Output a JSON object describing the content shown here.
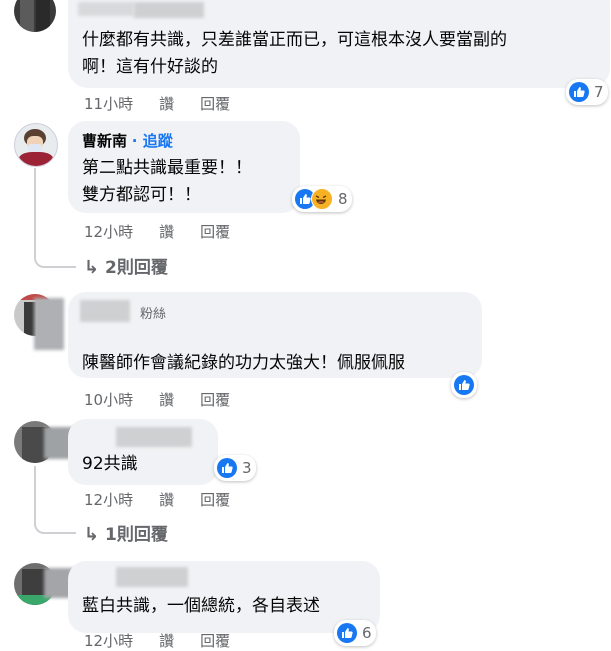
{
  "actions": {
    "like": "讚",
    "reply": "回覆"
  },
  "comments": [
    {
      "name": "",
      "lines": [
        "什麼都有共識，只差誰當正而已，可這根本沒人要當副的",
        "啊！這有什好談的"
      ],
      "time": "11小時",
      "reactions": {
        "icons": [
          "like-icon"
        ],
        "count": "7"
      }
    },
    {
      "name": "曹新南",
      "follow": "· 追蹤",
      "lines": [
        "第二點共識最重要！！",
        "雙方都認可！！"
      ],
      "time": "12小時",
      "reactions": {
        "icons": [
          "like-icon",
          "haha-icon"
        ],
        "count": "8"
      },
      "replies_link": "2則回覆"
    },
    {
      "name": "",
      "badge": "粉絲",
      "lines": [
        "陳醫師作會議紀錄的功力太強大！佩服佩服"
      ],
      "time": "10小時",
      "reactions": {
        "icons": [
          "like-icon"
        ],
        "count": ""
      }
    },
    {
      "name": "",
      "lines": [
        "92共識"
      ],
      "time": "12小時",
      "reactions": {
        "icons": [
          "like-icon"
        ],
        "count": "3"
      },
      "replies_link": "1則回覆"
    },
    {
      "name": "",
      "lines": [
        "藍白共識，一個總統，各自表述"
      ],
      "time": "12小時",
      "reactions": {
        "icons": [
          "like-icon"
        ],
        "count": "6"
      }
    }
  ],
  "colors": {
    "bubble": "#f0f2f5",
    "like_blue": "#1877f2",
    "meta": "#65676b",
    "haha": "#f7b125"
  }
}
